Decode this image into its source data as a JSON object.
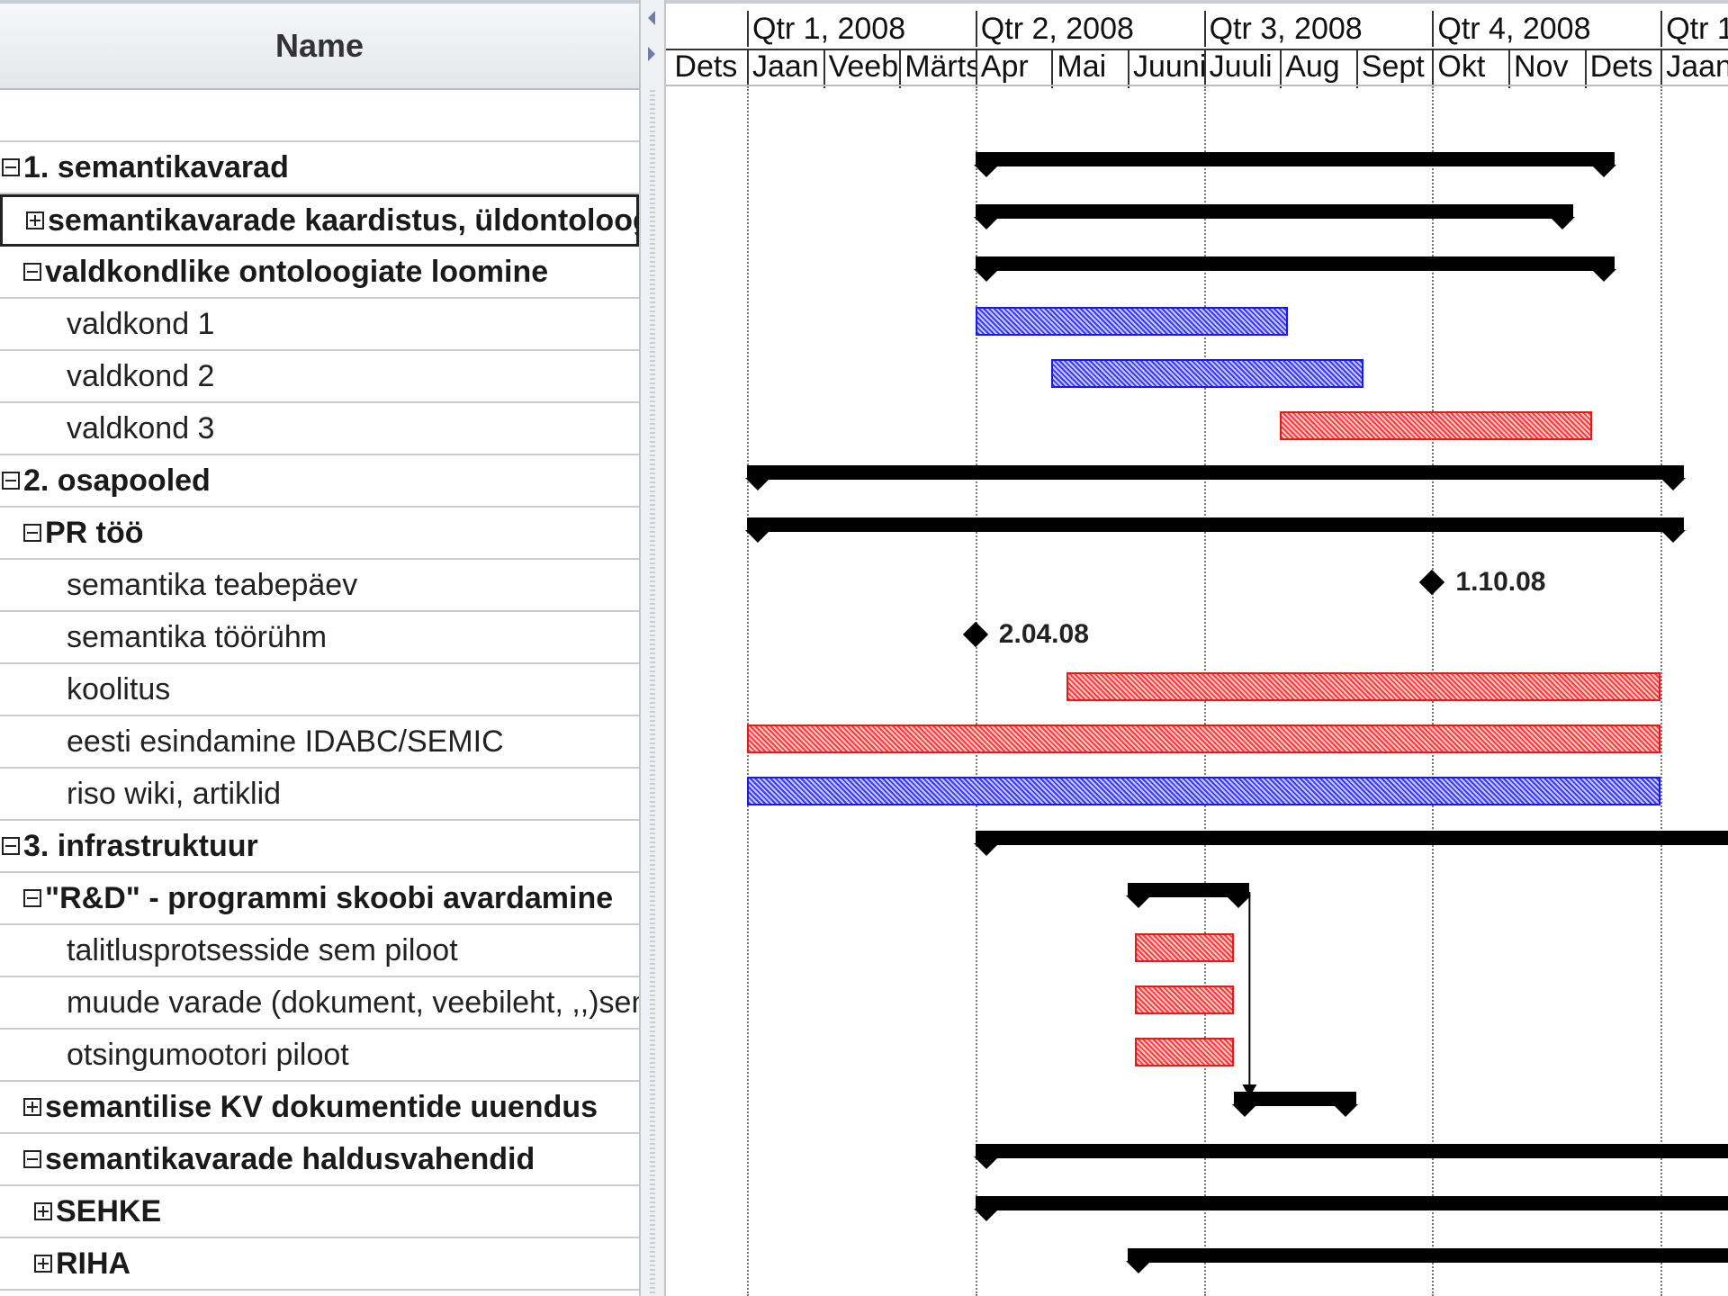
{
  "table": {
    "name_header": "Name",
    "rows": [
      {
        "label": "",
        "indent": 0,
        "toggle": null,
        "bold": false
      },
      {
        "label": "1. semantikavarad",
        "indent": 0,
        "toggle": "minus",
        "bold": true
      },
      {
        "label": "semantikavarade kaardistus, üldontoloogia",
        "indent": 1,
        "toggle": "plus",
        "bold": true,
        "selected": true
      },
      {
        "label": "valdkondlike ontoloogiate loomine",
        "indent": 1,
        "toggle": "minus",
        "bold": true
      },
      {
        "label": "valdkond 1",
        "indent": 2,
        "toggle": null,
        "bold": false
      },
      {
        "label": "valdkond 2",
        "indent": 2,
        "toggle": null,
        "bold": false
      },
      {
        "label": "valdkond 3",
        "indent": 2,
        "toggle": null,
        "bold": false
      },
      {
        "label": "2. osapooled",
        "indent": 0,
        "toggle": "minus",
        "bold": true
      },
      {
        "label": "PR töö",
        "indent": 1,
        "toggle": "minus",
        "bold": true
      },
      {
        "label": "semantika teabepäev",
        "indent": 2,
        "toggle": null,
        "bold": false
      },
      {
        "label": "semantika töörühm",
        "indent": 2,
        "toggle": null,
        "bold": false
      },
      {
        "label": "koolitus",
        "indent": 2,
        "toggle": null,
        "bold": false
      },
      {
        "label": "eesti esindamine IDABC/SEMIC",
        "indent": 2,
        "toggle": null,
        "bold": false
      },
      {
        "label": "riso wiki, artiklid",
        "indent": 2,
        "toggle": null,
        "bold": false
      },
      {
        "label": "3. infrastruktuur",
        "indent": 0,
        "toggle": "minus",
        "bold": true
      },
      {
        "label": "\"R&D\" - programmi skoobi avardamine",
        "indent": 1,
        "toggle": "minus",
        "bold": true
      },
      {
        "label": "talitlusprotsesside sem piloot",
        "indent": 2,
        "toggle": null,
        "bold": false
      },
      {
        "label": "muude varade (dokument, veebileht, ,,)semantika",
        "indent": 2,
        "toggle": null,
        "bold": false
      },
      {
        "label": "otsingumootori piloot",
        "indent": 2,
        "toggle": null,
        "bold": false
      },
      {
        "label": "semantilise KV dokumentide uuendus",
        "indent": 1,
        "toggle": "plus",
        "bold": true
      },
      {
        "label": "semantikavarade haldusvahendid",
        "indent": 1,
        "toggle": "minus",
        "bold": true
      },
      {
        "label": "SEHKE",
        "indent": 1.5,
        "toggle": "plus",
        "bold": true
      },
      {
        "label": "RIHA",
        "indent": 1.5,
        "toggle": "plus",
        "bold": true
      }
    ]
  },
  "timeline": {
    "quarters": [
      "Qtr 1, 2008",
      "Qtr 2, 2008",
      "Qtr 3, 2008",
      "Qtr 4, 2008",
      "Qtr 1"
    ],
    "months": [
      "Dets",
      "Jaan",
      "Veebr",
      "Märts",
      "Apr",
      "Mai",
      "Juuni",
      "Juuli",
      "Aug",
      "Sept",
      "Okt",
      "Nov",
      "Dets",
      "Jaan"
    ]
  },
  "gantt_items": [
    {
      "row": 1,
      "kind": "summary",
      "start": 3.0,
      "end": 11.4
    },
    {
      "row": 2,
      "kind": "summary",
      "start": 3.0,
      "end": 10.85
    },
    {
      "row": 3,
      "kind": "summary",
      "start": 3.0,
      "end": 11.4
    },
    {
      "row": 4,
      "kind": "task",
      "color": "blue",
      "start": 3.0,
      "end": 7.1
    },
    {
      "row": 5,
      "kind": "task",
      "color": "blue",
      "start": 4.0,
      "end": 8.1
    },
    {
      "row": 6,
      "kind": "task",
      "color": "red",
      "start": 7.0,
      "end": 11.1
    },
    {
      "row": 7,
      "kind": "summary",
      "start": 0.0,
      "end": 12.3
    },
    {
      "row": 8,
      "kind": "summary",
      "start": 0.0,
      "end": 12.3
    },
    {
      "row": 9,
      "kind": "milestone",
      "at": 9.0,
      "label": "1.10.08"
    },
    {
      "row": 10,
      "kind": "milestone",
      "at": 3.0,
      "label": "2.04.08"
    },
    {
      "row": 11,
      "kind": "task",
      "color": "red",
      "start": 4.2,
      "end": 12.0
    },
    {
      "row": 12,
      "kind": "task",
      "color": "red",
      "start": 0.0,
      "end": 12.0
    },
    {
      "row": 13,
      "kind": "task",
      "color": "blue",
      "start": 0.0,
      "end": 12.0
    },
    {
      "row": 14,
      "kind": "summary",
      "start": 3.0,
      "end": 13.5,
      "open_right": true
    },
    {
      "row": 15,
      "kind": "summary",
      "start": 5.0,
      "end": 6.6
    },
    {
      "row": 16,
      "kind": "task",
      "color": "red",
      "start": 5.1,
      "end": 6.4
    },
    {
      "row": 17,
      "kind": "task",
      "color": "red",
      "start": 5.1,
      "end": 6.4
    },
    {
      "row": 18,
      "kind": "task",
      "color": "red",
      "start": 5.1,
      "end": 6.4
    },
    {
      "row": 19,
      "kind": "summary",
      "start": 6.4,
      "end": 8.0
    },
    {
      "row": 20,
      "kind": "summary",
      "start": 3.0,
      "end": 13.5,
      "open_right": true
    },
    {
      "row": 21,
      "kind": "summary",
      "start": 3.0,
      "end": 13.5,
      "open_right": true
    },
    {
      "row": 22,
      "kind": "summary",
      "start": 5.0,
      "end": 13.5,
      "open_right": true
    }
  ],
  "dependency": {
    "from_row": 15,
    "to_row": 19,
    "at": 6.6
  },
  "colors": {
    "blue_fill": "#3a3aff",
    "red_fill": "#ff3a3a",
    "summary": "#000000",
    "header_bg": "#e4e6ea"
  }
}
